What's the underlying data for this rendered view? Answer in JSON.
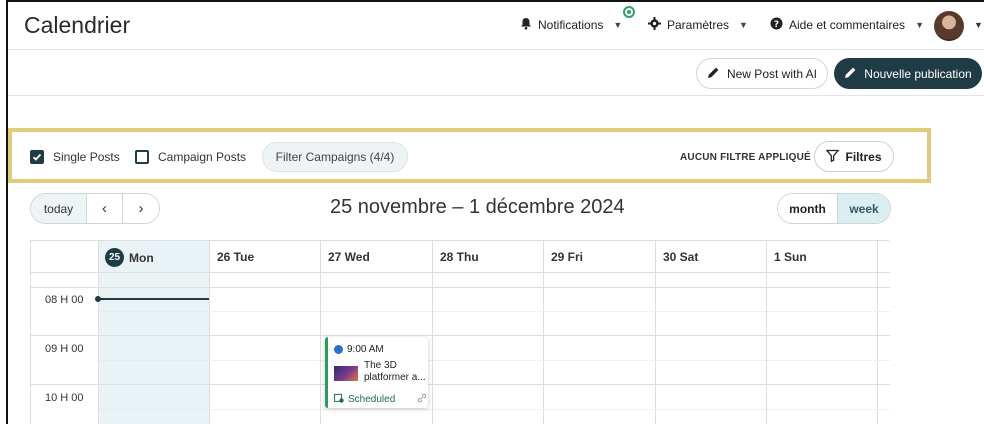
{
  "header": {
    "title": "Calendrier",
    "notifications_label": "Notifications",
    "settings_label": "Paramètres",
    "help_label": "Aide et commentaires"
  },
  "actions": {
    "new_post_ai_label": "New Post with AI",
    "new_publication_label": "Nouvelle publication"
  },
  "filters": {
    "single_posts_label": "Single Posts",
    "single_posts_checked": true,
    "campaign_posts_label": "Campaign Posts",
    "campaign_posts_checked": false,
    "filter_campaigns_label": "Filter Campaigns (4/4)",
    "no_filter_label": "AUCUN FILTRE APPLIQUÉ",
    "filters_button_label": "Filtres"
  },
  "calendar": {
    "today_label": "today",
    "prev_label": "‹",
    "next_label": "›",
    "range_title": "25 novembre – 1 décembre 2024",
    "view_month_label": "month",
    "view_week_label": "week",
    "active_view": "week",
    "today_badge": "25",
    "days": [
      {
        "label": "Mon"
      },
      {
        "label": "26 Tue"
      },
      {
        "label": "27 Wed"
      },
      {
        "label": "28 Thu"
      },
      {
        "label": "29 Fri"
      },
      {
        "label": "30 Sat"
      },
      {
        "label": "1 Sun"
      }
    ],
    "time_labels": [
      "08 H 00",
      "09 H 00",
      "10 H 00"
    ],
    "event": {
      "time": "9:00 AM",
      "title": "The 3D platformer a...",
      "status": "Scheduled",
      "day": "27 Wed"
    }
  },
  "colors": {
    "primary": "#1f3b46",
    "highlight_border": "#e0cd7c",
    "today_column": "#e9f3f6",
    "event_accent": "#2e9a60",
    "notification_dot": "#2ea46b"
  }
}
